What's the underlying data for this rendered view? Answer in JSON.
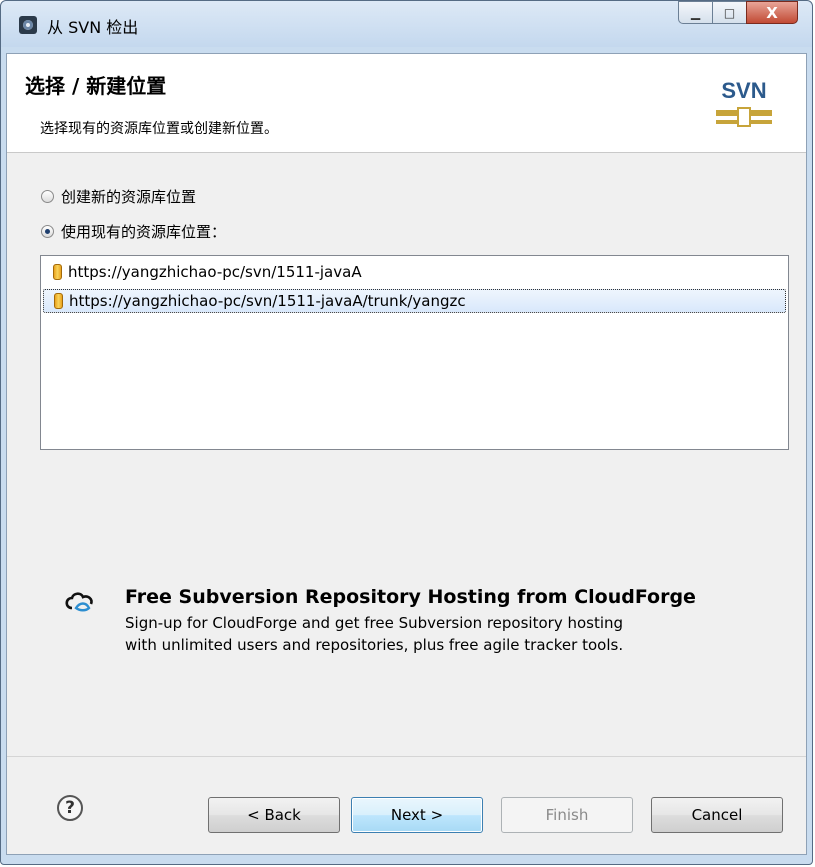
{
  "window": {
    "title": "从 SVN 检出",
    "controls": {
      "minimize": "▁",
      "maximize": "□",
      "close": "X"
    }
  },
  "banner": {
    "title": "选择 / 新建位置",
    "description": "选择现有的资源库位置或创建新位置。",
    "logo_text": "SVN"
  },
  "options": {
    "create_new_label": "创建新的资源库位置",
    "use_existing_label": "使用现有的资源库位置：",
    "selected": "use_existing"
  },
  "repositories": [
    {
      "url": "https://yangzhichao-pc/svn/1511-javaA",
      "selected": false
    },
    {
      "url": "https://yangzhichao-pc/svn/1511-javaA/trunk/yangzc",
      "selected": true
    }
  ],
  "cloudforge": {
    "title": "Free Subversion Repository Hosting from CloudForge",
    "line1": "Sign-up for CloudForge and get free Subversion repository hosting",
    "line2": "with unlimited users and repositories, plus free agile tracker tools."
  },
  "buttons": {
    "help": "?",
    "back": "< Back",
    "next": "Next >",
    "finish": "Finish",
    "cancel": "Cancel"
  },
  "colors": {
    "title_bar": "#c9dcef",
    "svn_blue": "#2c5a8c",
    "svn_gold": "#c7a43a",
    "default_button": "#bee6fd"
  }
}
